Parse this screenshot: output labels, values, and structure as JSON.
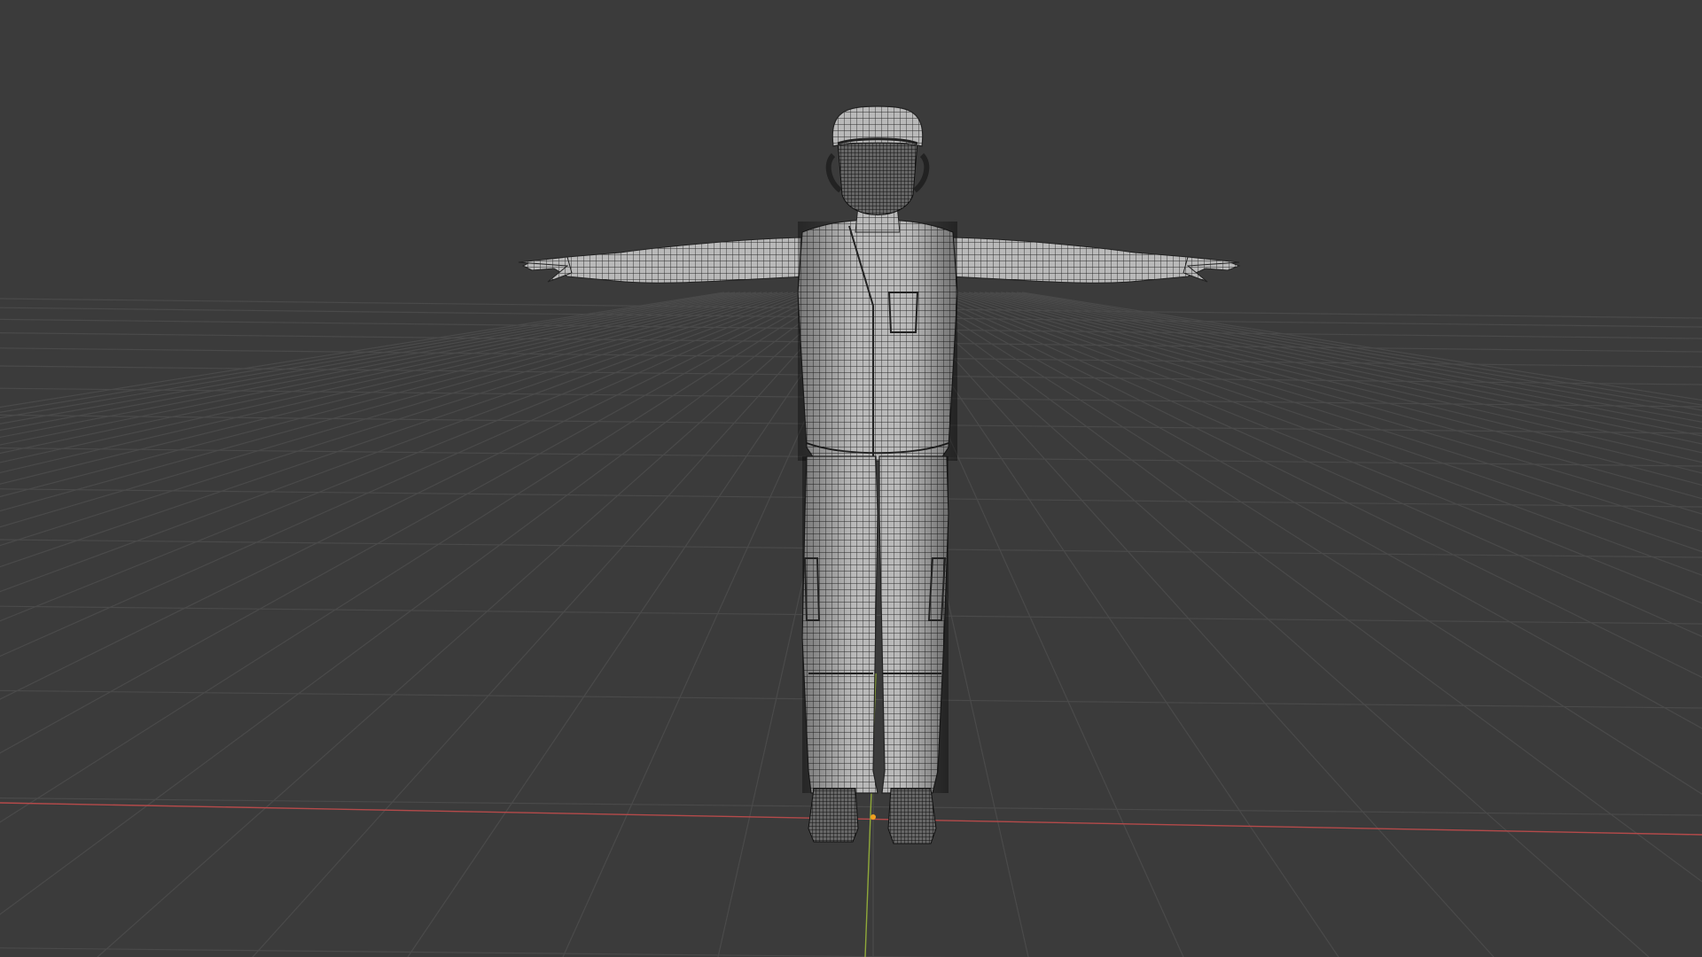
{
  "viewport": {
    "background": "#3b3b3b",
    "grid_color": "#4a4a4a",
    "x_axis_color": "#b44a4a",
    "y_axis_color": "#8fa83a",
    "mesh_surface_color": "#b9b9b9",
    "wire_color": "#1e1e1e",
    "shading_mode": "wireframe-overlay",
    "model_pose": "T-pose",
    "origin_marker_color": "#f0a020"
  }
}
